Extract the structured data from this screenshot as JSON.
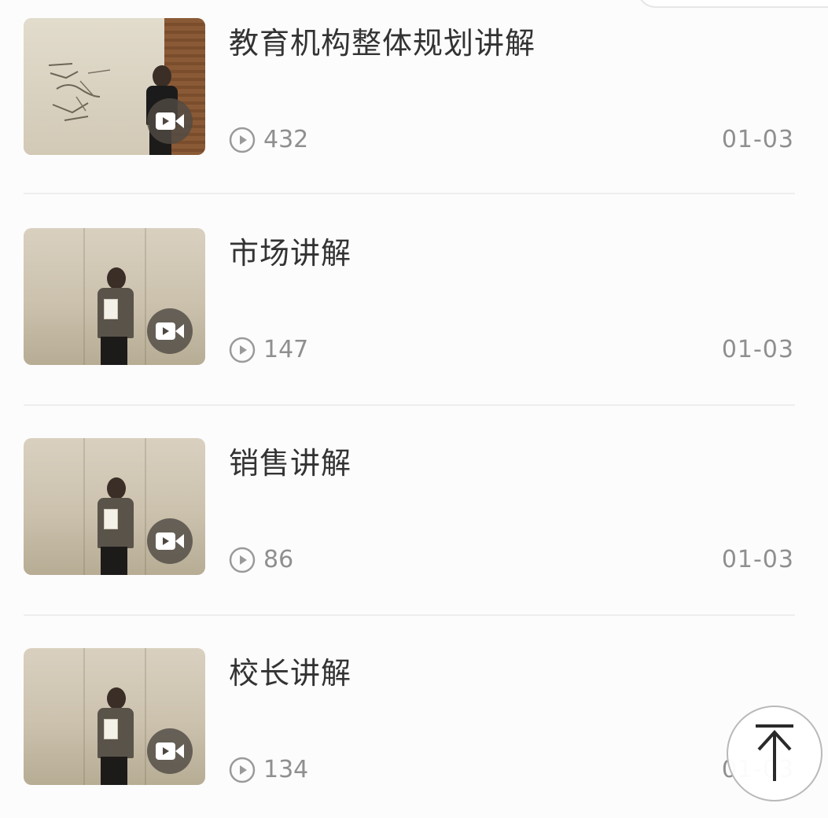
{
  "items": [
    {
      "title": "教育机构整体规划讲解",
      "views": "432",
      "date": "01-03",
      "thumb": "video-thumbnail-whiteboard-lecture"
    },
    {
      "title": "市场讲解",
      "views": "147",
      "date": "01-03",
      "thumb": "video-thumbnail-speaker"
    },
    {
      "title": "销售讲解",
      "views": "86",
      "date": "01-03",
      "thumb": "video-thumbnail-speaker"
    },
    {
      "title": "校长讲解",
      "views": "134",
      "date": "01-03",
      "thumb": "video-thumbnail-speaker"
    }
  ],
  "icons": {
    "video": "video-camera-icon",
    "plays": "play-circle-icon",
    "back_to_top": "arrow-up-to-top-icon"
  },
  "colors": {
    "title": "#333333",
    "meta": "#8f8f8f",
    "divider": "#eeeeee",
    "background": "#fdfcfc"
  }
}
